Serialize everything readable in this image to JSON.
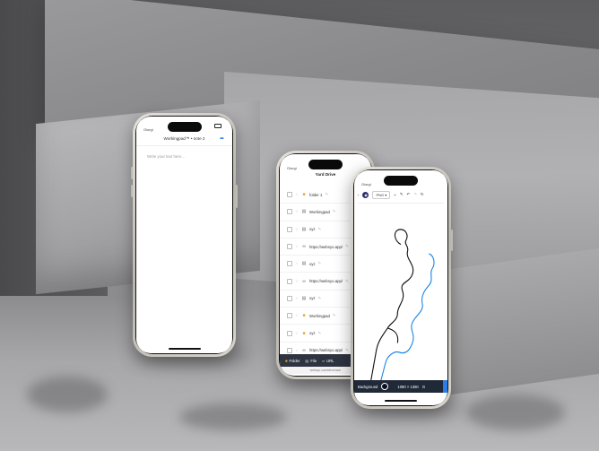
{
  "phones": {
    "notes": {
      "user": "Giorgi",
      "title": "Workingpad™ • note 2",
      "placeholder": "Write your text here..."
    },
    "drive": {
      "user": "Giorgi",
      "title": "Yard Drive",
      "items": [
        {
          "type": "folder",
          "name": "folder 1"
        },
        {
          "type": "file",
          "name": "Workingpad"
        },
        {
          "type": "file",
          "name": "xyz"
        },
        {
          "type": "link",
          "name": "https://websyo.app/"
        },
        {
          "type": "file",
          "name": "xyz"
        },
        {
          "type": "link",
          "name": "https://websyo.app/"
        },
        {
          "type": "file",
          "name": "xyz"
        },
        {
          "type": "folder",
          "name": "Workingpad"
        },
        {
          "type": "folder",
          "name": "xyz"
        },
        {
          "type": "link",
          "name": "https://websyo.app/"
        }
      ],
      "bottom": {
        "folder": "Folder",
        "file": "File",
        "url": "URL"
      },
      "url": "websyo.com/drive/user"
    },
    "draw": {
      "user": "Giorgi",
      "format": "PNG",
      "background_label": "Background",
      "size_label": "1080 × 1350",
      "colors": {
        "stroke_black": "#111111",
        "stroke_blue": "#1e88e5",
        "accent": "#2b7de9"
      }
    }
  }
}
